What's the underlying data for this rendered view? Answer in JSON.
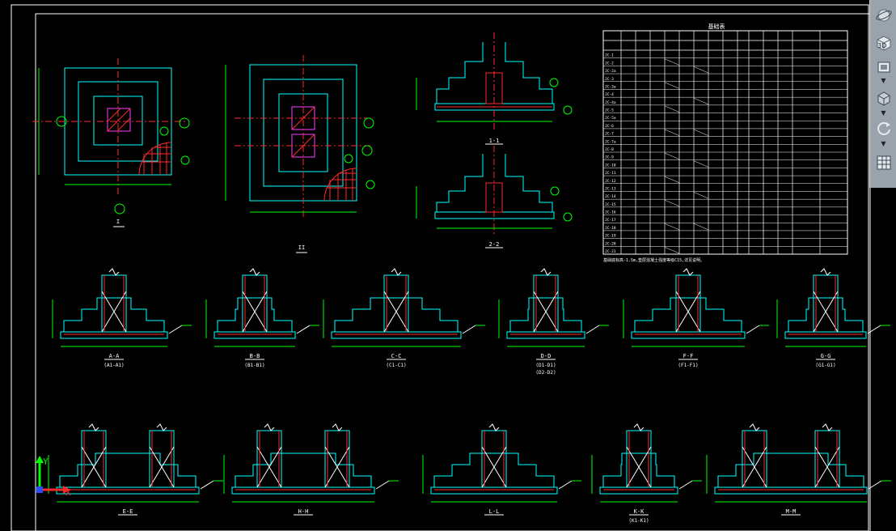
{
  "drawing": {
    "table_title": "基础表",
    "table_footnote": "基础底标高-1.5m,垫层混凝土强度等级C15,详见说明。",
    "plan_views": [
      {
        "label": "1-1",
        "mark": "1",
        "sub": "I"
      },
      {
        "label": "2-2",
        "mark": "2",
        "sub": "II"
      }
    ],
    "section_titles": [
      "1-1",
      "2-2"
    ],
    "row1_sections": [
      {
        "title": "A-A",
        "sub": "(A1-A1)"
      },
      {
        "title": "B-B",
        "sub": "(B1-B1)"
      },
      {
        "title": "C-C",
        "sub": "(C1-C1)"
      },
      {
        "title": "D-D",
        "sub": "(D1-D1)",
        "sub2": "(D2-D2)"
      },
      {
        "title": "F-F",
        "sub": "(F1-F1)"
      },
      {
        "title": "G-G",
        "sub": "(G1-G1)"
      }
    ],
    "row2_sections": [
      {
        "title": "E-E"
      },
      {
        "title": "H-H"
      },
      {
        "title": "L-L"
      },
      {
        "title": "K-K",
        "sub": "(K1-K1)"
      },
      {
        "title": "M-M"
      }
    ],
    "table_rows": [
      "JC-1",
      "JC-2",
      "JC-2a",
      "JC-3",
      "JC-3a",
      "JC-4",
      "JC-4a",
      "JC-5",
      "JC-5a",
      "JC-6",
      "JC-7",
      "JC-7a",
      "JC-8",
      "JC-9",
      "JC-10",
      "JC-11",
      "JC-12",
      "JC-13",
      "JC-14",
      "JC-15",
      "JC-16",
      "JC-17",
      "JC-18",
      "JC-19",
      "JC-20",
      "JC-21"
    ],
    "ucs": {
      "x_label": "X",
      "y_label": "Y"
    }
  },
  "toolbar": {
    "view_cube_label": "3D",
    "buttons": [
      "orbit",
      "view-cube",
      "visual-style",
      "rotate",
      "layout-grid"
    ]
  },
  "colors": {
    "background": "#000000",
    "cyan": "#00ffff",
    "red": "#ff2a2a",
    "green": "#00ff00",
    "yellow": "#ffff00",
    "white": "#ffffff",
    "magenta": "#ff40ff",
    "toolbar": "#9aa3ab"
  }
}
